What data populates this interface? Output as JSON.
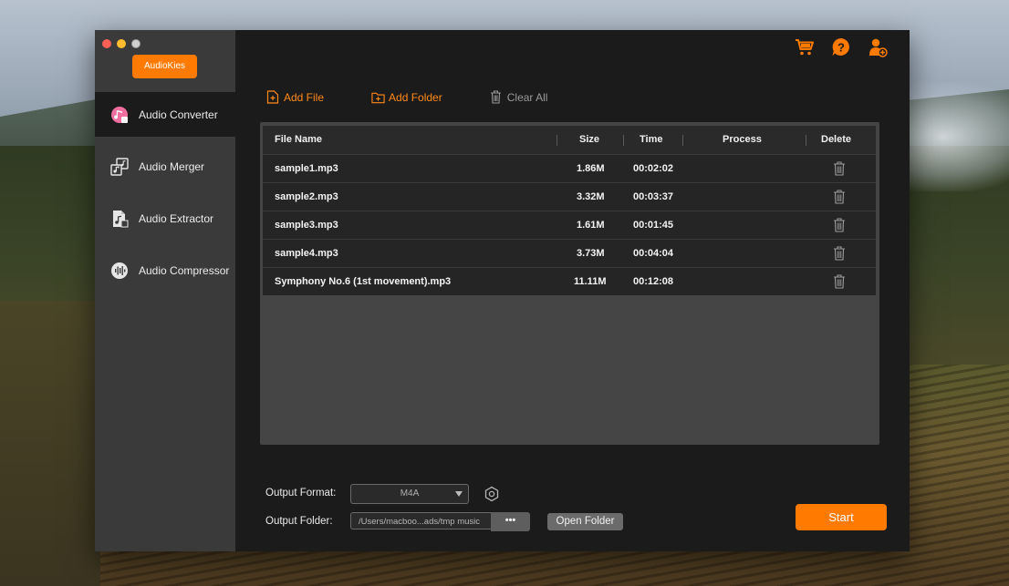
{
  "app": {
    "brand_label": "AudioKies",
    "accent_color": "#ff7a00"
  },
  "sidebar": {
    "items": [
      {
        "label": "Audio Converter",
        "icon": "music-note-pink-icon",
        "active": true
      },
      {
        "label": "Audio Merger",
        "icon": "music-files-icon",
        "active": false
      },
      {
        "label": "Audio Extractor",
        "icon": "file-extract-icon",
        "active": false
      },
      {
        "label": "Audio Compressor",
        "icon": "waveform-icon",
        "active": false
      }
    ]
  },
  "header": {
    "icons": [
      "cart-icon",
      "help-icon",
      "user-add-icon"
    ]
  },
  "toolbar": {
    "add_file": "Add File",
    "add_folder": "Add Folder",
    "clear_all": "Clear All"
  },
  "table": {
    "columns": [
      "File Name",
      "Size",
      "Time",
      "Process",
      "Delete"
    ],
    "rows": [
      {
        "name": "sample1.mp3",
        "size": "1.86M",
        "time": "00:02:02",
        "process": ""
      },
      {
        "name": "sample2.mp3",
        "size": "3.32M",
        "time": "00:03:37",
        "process": ""
      },
      {
        "name": "sample3.mp3",
        "size": "1.61M",
        "time": "00:01:45",
        "process": ""
      },
      {
        "name": "sample4.mp3",
        "size": "3.73M",
        "time": "00:04:04",
        "process": ""
      },
      {
        "name": "Symphony No.6 (1st movement).mp3",
        "size": "11.11M",
        "time": "00:12:08",
        "process": ""
      }
    ]
  },
  "output": {
    "format_label": "Output Format:",
    "format_value": "M4A",
    "folder_label": "Output Folder:",
    "folder_path": "/Users/macboo...ads/tmp music",
    "browse_label": "•••",
    "open_folder_label": "Open Folder",
    "start_label": "Start"
  }
}
